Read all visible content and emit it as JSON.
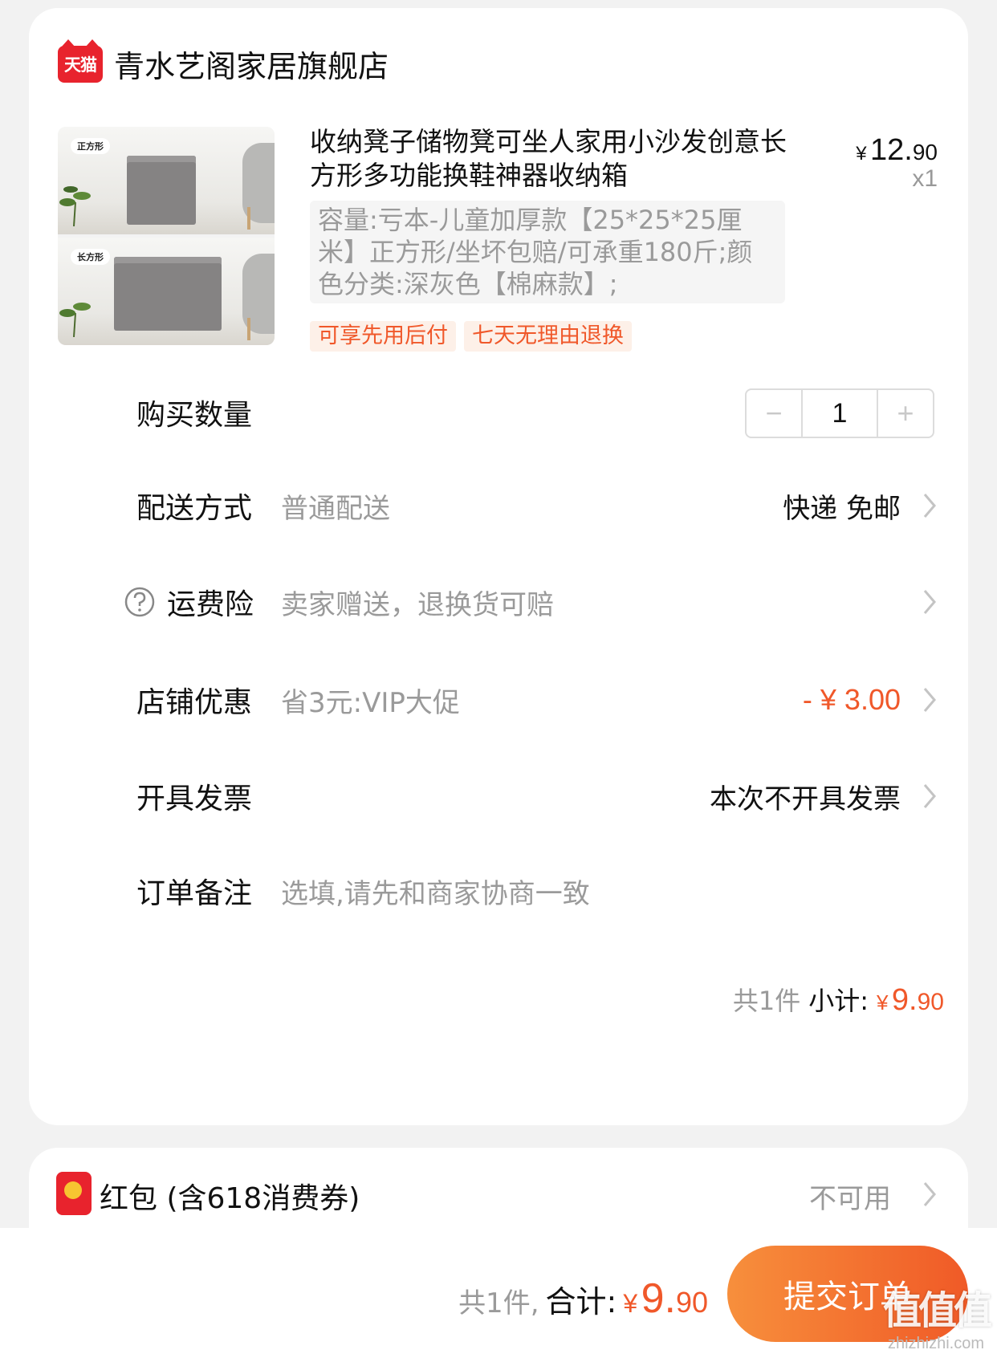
{
  "shop": {
    "badge": "天猫",
    "name": "青水艺阁家居旗舰店"
  },
  "product": {
    "thumb_tags": [
      "正方形",
      "长方形"
    ],
    "title": "收纳凳子储物凳可坐人家用小沙发创意长方形多功能换鞋神器收纳箱",
    "price": {
      "currency": "¥",
      "int": "12.",
      "dec": "90"
    },
    "quantity_label": "x1",
    "spec": "容量:亏本-儿童加厚款【25*25*25厘米】正方形/坐坏包赔/可承重180斤;颜色分类:深灰色【棉麻款】;",
    "tags": [
      "可享先用后付",
      "七天无理由退换"
    ]
  },
  "rows": {
    "quantity": {
      "label": "购买数量",
      "minus": "−",
      "value": "1",
      "plus": "+"
    },
    "delivery": {
      "label": "配送方式",
      "sub": "普通配送",
      "value": "快递 免邮"
    },
    "insurance": {
      "label": "运费险",
      "sub": "卖家赠送，退换货可赔"
    },
    "discount": {
      "label": "店铺优惠",
      "sub": "省3元:VIP大促",
      "value": "- ¥ 3.00"
    },
    "invoice": {
      "label": "开具发票",
      "value": "本次不开具发票"
    },
    "note": {
      "label": "订单备注",
      "placeholder": "选填,请先和商家协商一致"
    }
  },
  "subtotal": {
    "count": "共1件",
    "label": "小计:",
    "currency": "¥",
    "int": "9.",
    "dec": "90"
  },
  "hongbao": {
    "label": "红包 (含618消费券)",
    "status": "不可用"
  },
  "bottom": {
    "count": "共1件,",
    "label": "合计:",
    "currency": "¥",
    "int": "9.",
    "dec": "90",
    "submit": "提交订单"
  },
  "watermark": {
    "big": "值值值",
    "small": "zhizhizhi.com"
  },
  "colors": {
    "accent": "#f0582a",
    "tmall_red": "#e8232d",
    "muted": "#9a9a9a"
  }
}
